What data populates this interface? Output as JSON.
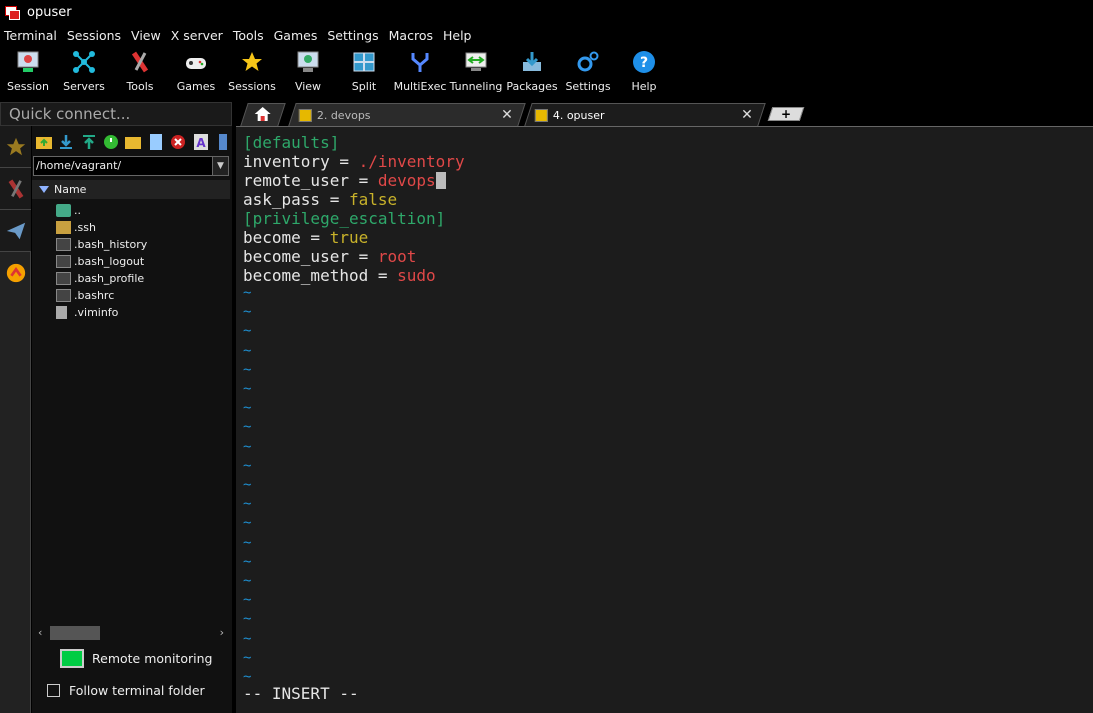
{
  "window": {
    "title": "opuser"
  },
  "menu": [
    "Terminal",
    "Sessions",
    "View",
    "X server",
    "Tools",
    "Games",
    "Settings",
    "Macros",
    "Help"
  ],
  "toolbar": [
    {
      "label": "Session",
      "icon": "session-icon"
    },
    {
      "label": "Servers",
      "icon": "servers-icon"
    },
    {
      "label": "Tools",
      "icon": "tools-icon"
    },
    {
      "label": "Games",
      "icon": "games-icon"
    },
    {
      "label": "Sessions",
      "icon": "star-icon"
    },
    {
      "label": "View",
      "icon": "view-icon"
    },
    {
      "label": "Split",
      "icon": "split-icon"
    },
    {
      "label": "MultiExec",
      "icon": "multiexec-icon"
    },
    {
      "label": "Tunneling",
      "icon": "tunneling-icon"
    },
    {
      "label": "Packages",
      "icon": "packages-icon"
    },
    {
      "label": "Settings",
      "icon": "settings-icon"
    },
    {
      "label": "Help",
      "icon": "help-icon"
    }
  ],
  "quick_connect": {
    "placeholder": "Quick connect..."
  },
  "tabs": [
    {
      "label": "2. devops",
      "close": "✕"
    },
    {
      "label": "4. opuser",
      "close": "✕"
    }
  ],
  "sftp": {
    "path": "/home/vagrant/",
    "column": "Name",
    "files": [
      "..",
      ".ssh",
      ".bash_history",
      ".bash_logout",
      ".bash_profile",
      ".bashrc",
      ".viminfo"
    ],
    "remote_monitoring": "Remote monitoring",
    "follow_folder": "Follow terminal folder"
  },
  "terminal": {
    "lines": [
      {
        "parts": [
          {
            "t": "[defaults]",
            "c": "green"
          }
        ]
      },
      {
        "parts": [
          {
            "t": "inventory",
            "c": "white"
          },
          {
            "t": " = ",
            "c": "white"
          },
          {
            "t": "./inventory",
            "c": "red"
          }
        ]
      },
      {
        "parts": [
          {
            "t": "remote_user",
            "c": "white"
          },
          {
            "t": " = ",
            "c": "white"
          },
          {
            "t": "devops",
            "c": "red"
          }
        ],
        "cursor": true
      },
      {
        "parts": [
          {
            "t": "ask_pass",
            "c": "white"
          },
          {
            "t": " = ",
            "c": "white"
          },
          {
            "t": "false",
            "c": "yellow"
          }
        ]
      },
      {
        "parts": [
          {
            "t": "[privilege_escaltion]",
            "c": "green"
          }
        ]
      },
      {
        "parts": [
          {
            "t": "become",
            "c": "white"
          },
          {
            "t": " = ",
            "c": "white"
          },
          {
            "t": "true",
            "c": "yellow"
          }
        ]
      },
      {
        "parts": [
          {
            "t": "become_user",
            "c": "white"
          },
          {
            "t": " = ",
            "c": "white"
          },
          {
            "t": "root",
            "c": "red"
          }
        ]
      },
      {
        "parts": [
          {
            "t": "become_method",
            "c": "white"
          },
          {
            "t": " = ",
            "c": "white"
          },
          {
            "t": "sudo",
            "c": "red"
          }
        ]
      }
    ],
    "tilde": "~",
    "tilde_count": 21,
    "status": "-- INSERT --"
  }
}
